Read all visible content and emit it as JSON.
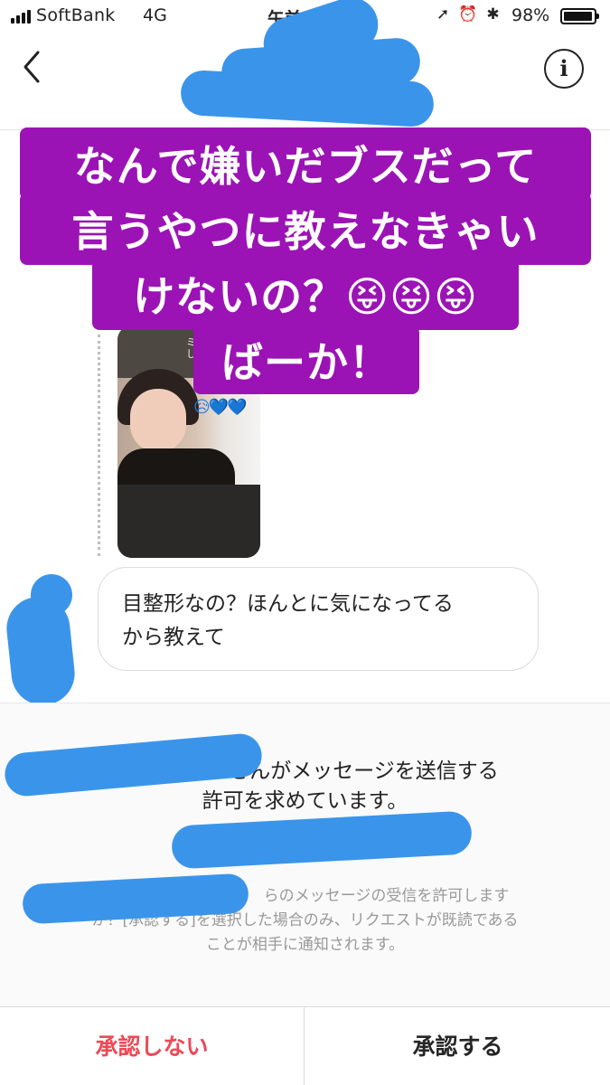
{
  "status_bar": {
    "carrier": "SoftBank",
    "network": "4G",
    "time": "午前9:3",
    "icons": [
      "location-icon",
      "alarm-icon",
      "bluetooth-icon"
    ],
    "battery": "98%",
    "battery_level": 0.98
  },
  "header": {
    "back_icon": "chevron-left-icon",
    "info_label": "i"
  },
  "story_reply": {
    "story_text_line1": "ミ",
    "story_text_line2": "し",
    "story_emoji": "😥💙💙"
  },
  "message": {
    "text_line1": "目整形なの？ほんとに気になってる",
    "text_line2": "から教えて"
  },
  "caption": {
    "line1": "なんで嫌いだブスだって",
    "line2": "言うやつに教えなきゃい",
    "line3": "けないの？😝😝😝",
    "line4": "ばーか！"
  },
  "request": {
    "title_line1": "さんがメッセージを送信する",
    "title_line2": "許可を求めています。",
    "sub_line1": "らのメッセージの受信を許可します",
    "sub_line2": "か？[承認する]を選択した場合のみ、リクエストが既読である",
    "sub_line3": "ことが相手に通知されます。"
  },
  "buttons": {
    "decline": "承認しない",
    "accept": "承認する"
  },
  "colors": {
    "caption_bg": "#9b13b5",
    "scribble": "#3a95ea",
    "decline": "#ed4956"
  }
}
